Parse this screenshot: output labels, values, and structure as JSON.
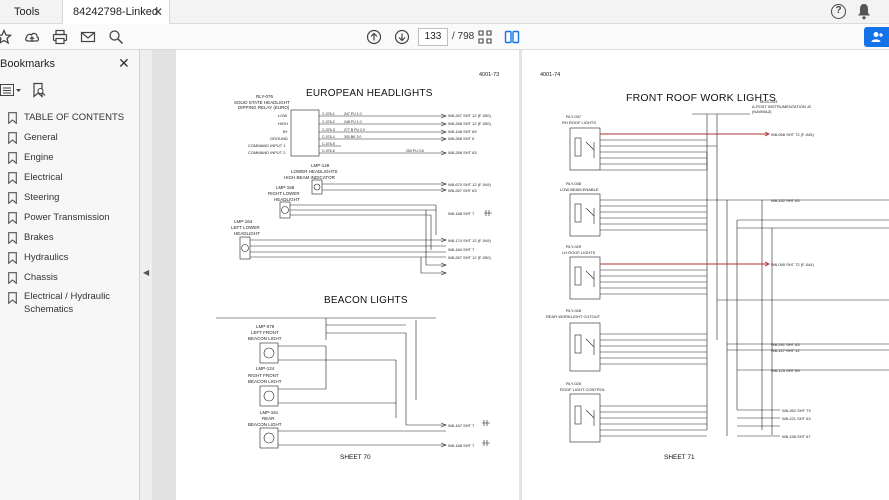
{
  "tabs": {
    "tools": "Tools",
    "document": "84242798-Linked p..."
  },
  "toolbar": {
    "page_current": "133",
    "page_total": "/ 798"
  },
  "sidebar": {
    "title": "Bookmarks",
    "items": [
      {
        "label": "TABLE OF CONTENTS"
      },
      {
        "label": "General"
      },
      {
        "label": "Engine"
      },
      {
        "label": "Electrical"
      },
      {
        "label": "Steering"
      },
      {
        "label": "Power Transmission"
      },
      {
        "label": "Brakes"
      },
      {
        "label": "Hydraulics"
      },
      {
        "label": "Chassis"
      },
      {
        "label": "Electrical / Hydraulic Schematics"
      }
    ]
  },
  "left_page": {
    "sheet_id": "4001-73",
    "title1": "EUROPEAN HEADLIGHTS",
    "title2": "BEACON LIGHTS",
    "sheet": "SHEET  70",
    "relay_labels": [
      "RLY-076",
      "SOLID STATE HEADLIGHT",
      "DIPPING RELAY (EURO)"
    ],
    "relay_pins": [
      "LOW",
      "HIGH",
      "B+",
      "GROUND",
      "COMMAND INPUT 1",
      "COMMAND INPUT 2"
    ],
    "connectors": [
      "C-076-1",
      "C-076-2",
      "C-076-3",
      "C-076-4",
      "C-076-5",
      "C-076-6"
    ],
    "wires": [
      "247 PU 1.0",
      "248 PU 1.0",
      "277 B PU 2.0",
      "300 BK 3.0",
      "",
      "253 PU 0.8"
    ],
    "targets": [
      "W8-267  SHT 12 (F-050)",
      "W8-268  SHT 12 (F-050)",
      "W8-148  SHT 69",
      "W8-268  SHT 6",
      "",
      "W8-268  SHT 63"
    ],
    "lamp_labels": [
      "LMP-148",
      "LOWER HEADLIGHTS",
      "HIGH BEAM INDICATOR",
      "LMP-158",
      "RIGHT LOWER",
      "HEADLIGHT",
      "LMP-164",
      "LEFT LOWER",
      "HEADLIGHT"
    ],
    "beacon_labels": [
      "LMP-076",
      "LEFT FRONT",
      "BEACON LIGHT",
      "LMP-124",
      "RIGHT FRONT",
      "BEACON LIGHT",
      "LMP-161",
      "REAR",
      "BEACON LIGHT"
    ],
    "mid_targets": [
      "W8-670  SHT 12 (F-049)",
      "W8-267  SHT 63",
      "W8-168  SHT 7",
      "W8-174  SHT 12 (F-049)",
      "W8-184  SHT 7",
      "W8-267  SHT 12 (F-050)"
    ],
    "bottom_targets": [
      "W8-167  SHT 7",
      "W8-168  SHT 7"
    ]
  },
  "right_page": {
    "sheet_id": "4001-74",
    "title": "FRONT ROOF WORK LIGHTS",
    "sheet": "SHEET  71",
    "top_ref": [
      "MOD-033",
      "A-POST INSTRUMENTATION  J2",
      "(NAVIBAZ)"
    ],
    "relays": [
      {
        "id": "RLY-037",
        "name": "RH ROOF LIGHTS"
      },
      {
        "id": "RLY-038",
        "name": "LOW BEAM ENABLE"
      },
      {
        "id": "RLY-029",
        "name": "LH ROOF LIGHTS"
      },
      {
        "id": "RLY-028",
        "name": "REAR WORKLIGHT CUTOUT"
      },
      {
        "id": "RLY-025",
        "name": "ROOF LIGHT CONTROL"
      }
    ],
    "targets": [
      "W8-058  SHT 72 (F-045)",
      "W8-152  SHT 63",
      "W8-059  SHT 72 (F-044)",
      "W8-291  SHT 63",
      "W8-127  SHT 12",
      "W8-125  SHT 69",
      "W8-262  SHT 73",
      "W8-221  SHT 63",
      "W8-158  SHT 67"
    ]
  },
  "colors": {
    "accent": "#1473e6",
    "red_wire": "#b03030"
  }
}
